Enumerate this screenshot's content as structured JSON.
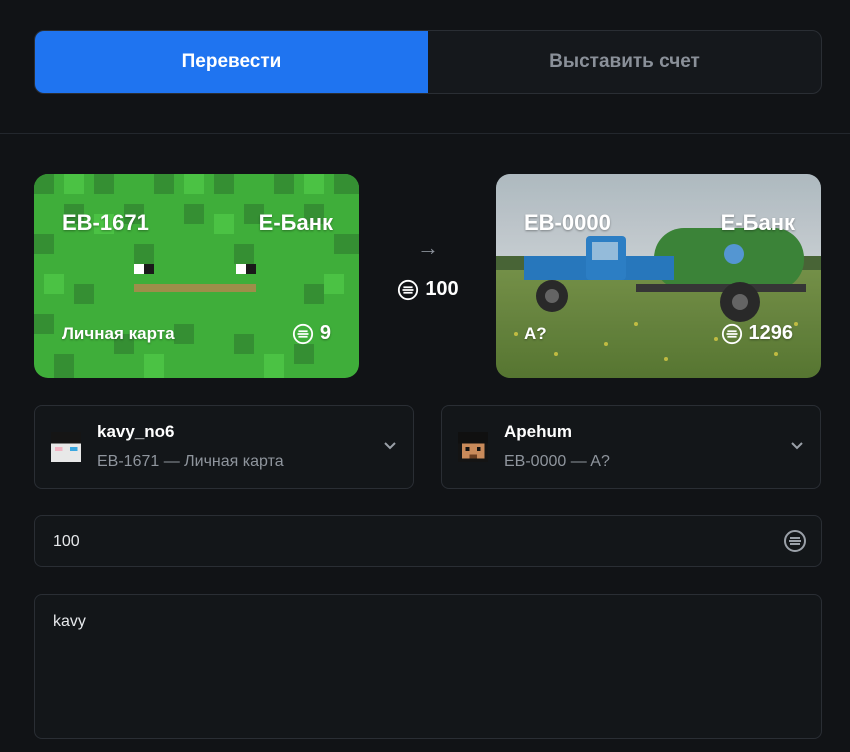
{
  "tabs": {
    "transfer": "Перевести",
    "invoice": "Выставить счет",
    "active": "transfer"
  },
  "from_card": {
    "id": "EB-1671",
    "bank": "Е-Банк",
    "label": "Личная карта",
    "balance": "9"
  },
  "to_card": {
    "id": "EB-0000",
    "bank": "Е-Банк",
    "label": "A?",
    "balance": "1296"
  },
  "transfer": {
    "amount_display": "100"
  },
  "from_select": {
    "name": "kavy_no6",
    "sub": "EB-1671 — Личная карта"
  },
  "to_select": {
    "name": "Apehum",
    "sub": "EB-0000 — A?"
  },
  "amount_input": {
    "value": "100"
  },
  "comment": {
    "value": "kavy"
  },
  "colors": {
    "accent": "#1f74f0",
    "background": "#111316",
    "border": "#2a2e34"
  },
  "icons": {
    "currency": "coin-icon",
    "arrow": "arrow-right-icon",
    "chevron": "chevron-down-icon"
  }
}
